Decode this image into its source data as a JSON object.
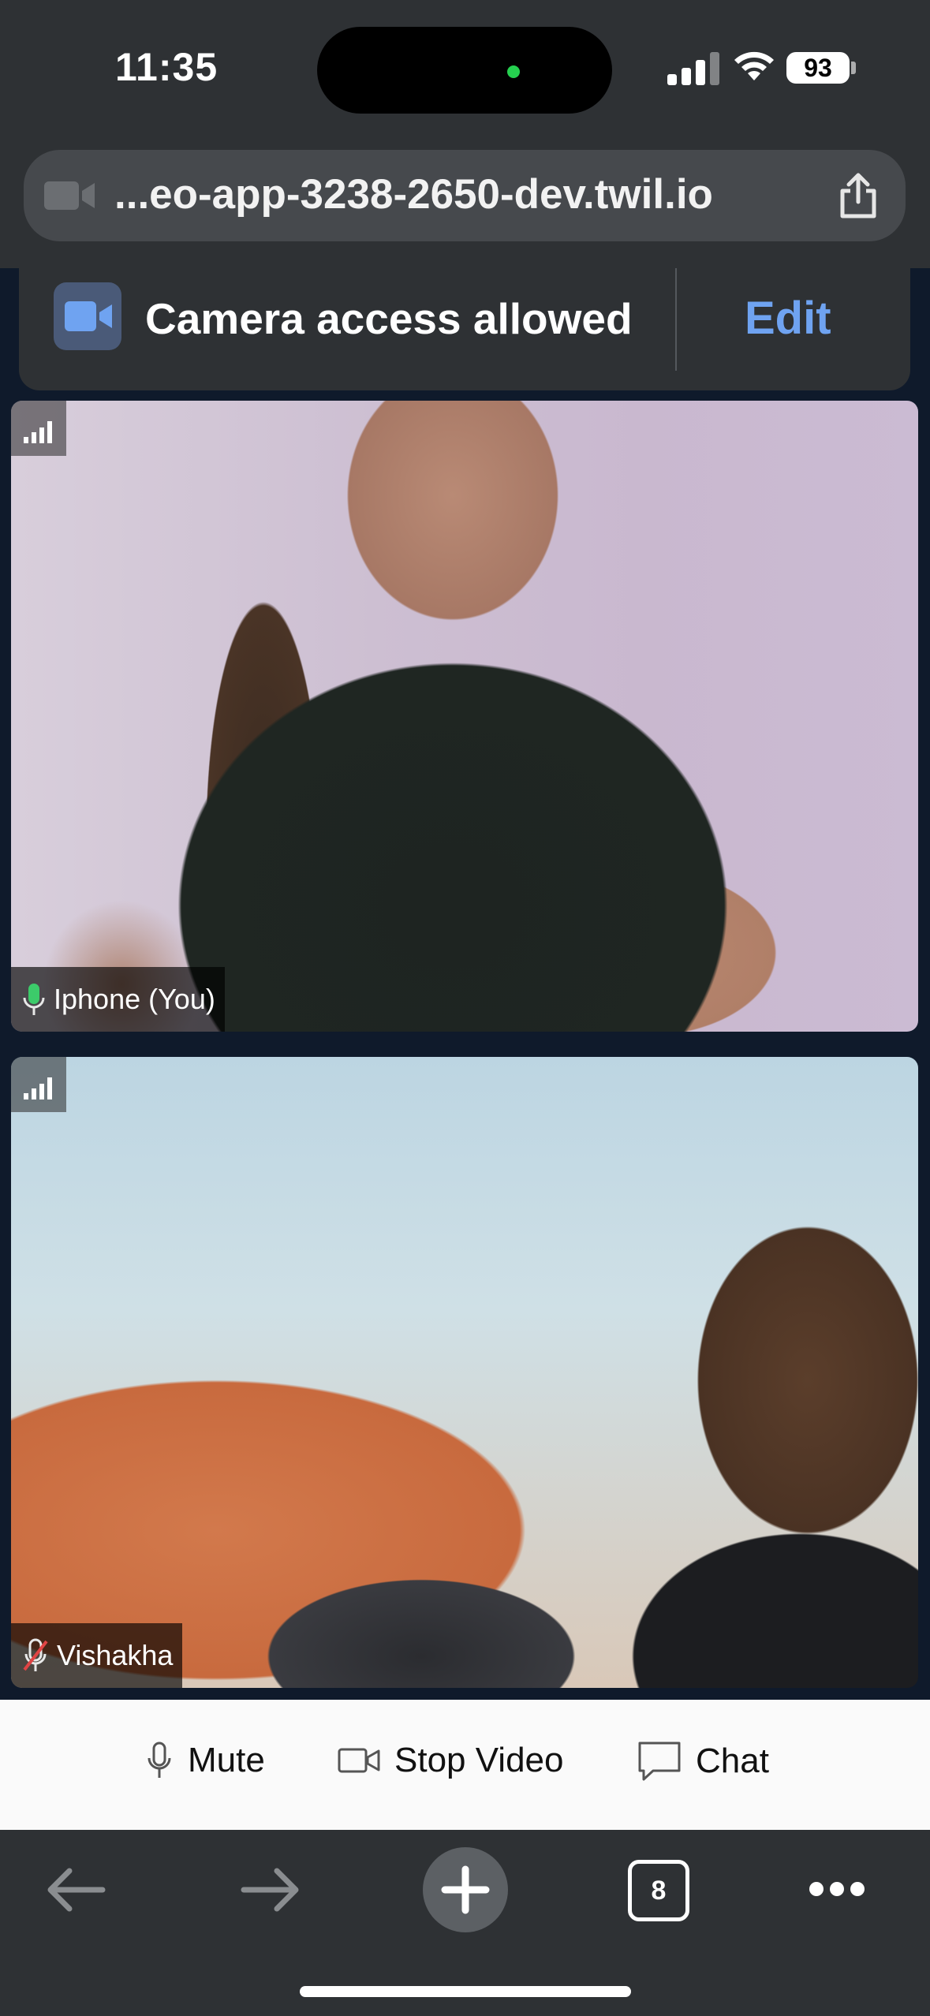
{
  "status_bar": {
    "time": "11:35",
    "battery": "93"
  },
  "browser": {
    "url": "...eo-app-3238-2650-dev.twil.io"
  },
  "permission_toast": {
    "text": "Camera access allowed",
    "action": "Edit"
  },
  "participants": [
    {
      "name": "Iphone (You)",
      "mic": "on"
    },
    {
      "name": "Vishakha",
      "mic": "muted"
    }
  ],
  "controls": {
    "mute": "Mute",
    "stop_video": "Stop Video",
    "chat": "Chat"
  },
  "toolbar": {
    "tab_count": "8"
  },
  "colors": {
    "accent": "#6fa3f1",
    "chrome": "#2e3134",
    "muted": "#e04444",
    "mic_on": "#3ccb6a"
  }
}
